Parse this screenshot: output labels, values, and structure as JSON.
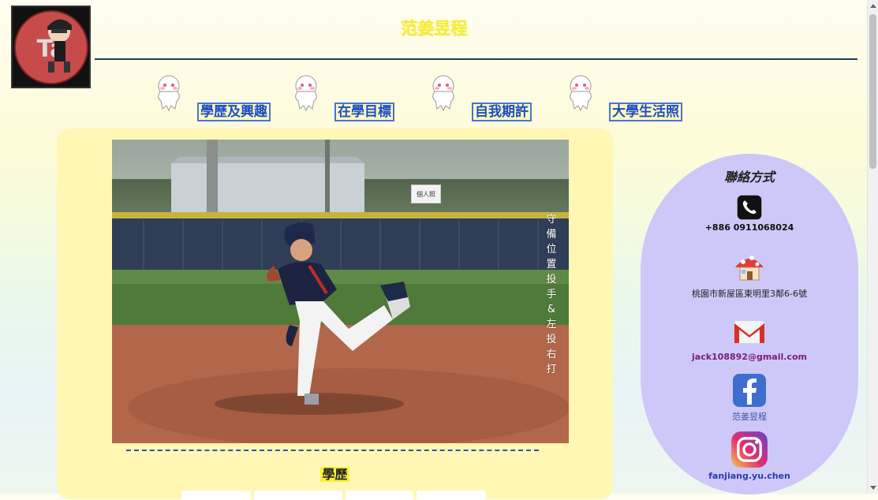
{
  "header": {
    "site_title": "范姜昱程",
    "logo_text": "Taoyuan"
  },
  "nav": {
    "items": [
      {
        "label": "學歷及興趣",
        "icon": "ghost-mascot-icon"
      },
      {
        "label": "在學目標",
        "icon": "ghost-mascot-icon"
      },
      {
        "label": "自我期許",
        "icon": "ghost-mascot-icon"
      },
      {
        "label": "大學生活照",
        "icon": "ghost-mascot-icon"
      }
    ]
  },
  "main": {
    "photo_tag": "個人照",
    "photo_caption": "守備位置投手&左投右打",
    "section_title": "學歷"
  },
  "contact": {
    "title": "聯絡方式",
    "phone": "+886 0911068024",
    "address": "桃園市新屋區東明里3鄰6-6號",
    "email": "jack108892@gmail.com",
    "facebook": "范姜昱程",
    "instagram": "fanjiang.yu.chen"
  },
  "colors": {
    "nav_link": "#1a4ec6",
    "main_panel": "#fff7b3",
    "contact_panel": "#cdc8f8",
    "title_color": "#f4ec3a"
  }
}
